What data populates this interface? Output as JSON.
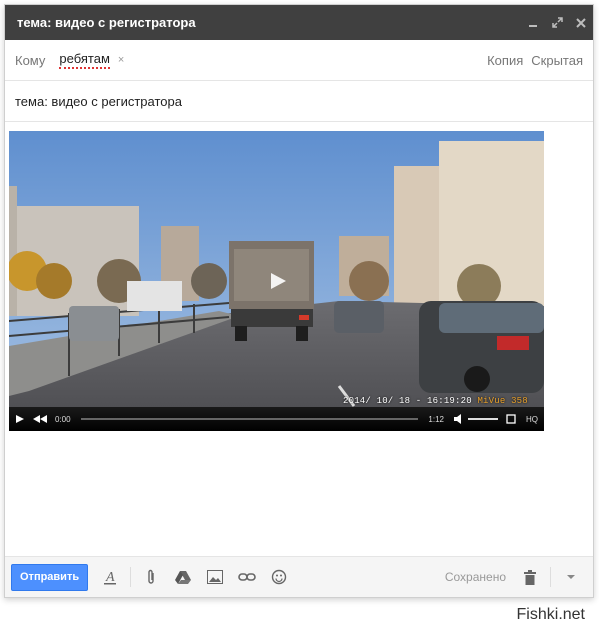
{
  "window": {
    "title": "тема: видео с регистратора",
    "controls": [
      "minimize-icon",
      "expand-icon",
      "close-icon"
    ]
  },
  "recipients": {
    "to_label": "Кому",
    "to_chip": "ребятам",
    "remove_symbol": "×",
    "cc_label": "Копия",
    "bcc_label": "Скрытая"
  },
  "subject": {
    "value": "тема: видео с регистратора"
  },
  "video": {
    "timestamp": "2014/ 10/ 18 - 16:19:20",
    "brand": "MiVue",
    "model": "358",
    "current_time": "0:00",
    "duration": "1:12",
    "quality": "HQ",
    "progress": 0,
    "volume": 0.8
  },
  "footer": {
    "send_label": "Отправить",
    "saved_label": "Сохранено",
    "icons": [
      "format-text-icon",
      "attach-icon",
      "drive-icon",
      "photo-icon",
      "link-icon",
      "emoji-icon",
      "trash-icon",
      "more-options-icon"
    ]
  },
  "watermark": "Fishki.net",
  "colors": {
    "titlebar": "#404040",
    "send_button": "#4d90fe",
    "spellcheck_underline": "#dd3333"
  }
}
